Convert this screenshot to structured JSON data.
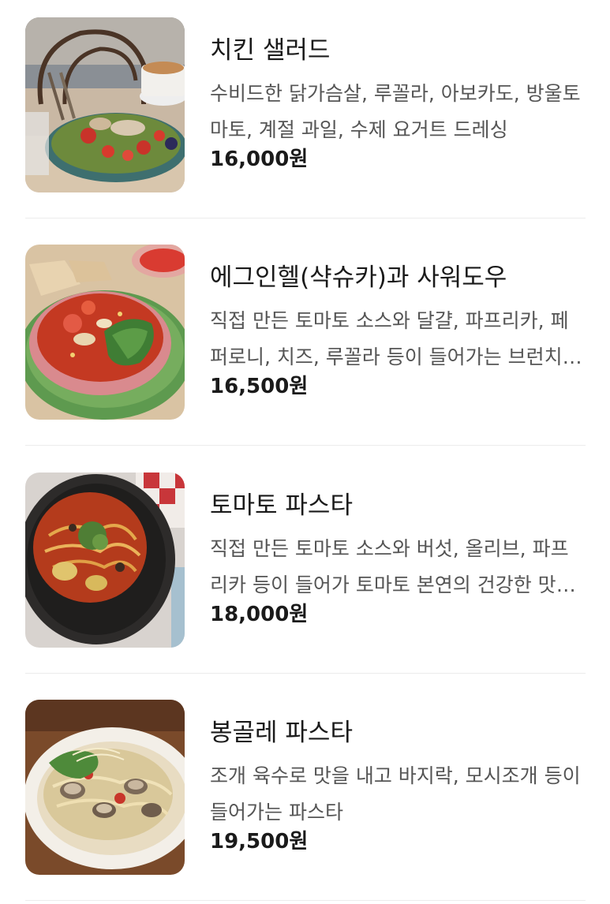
{
  "menu": {
    "items": [
      {
        "name": "치킨 샐러드",
        "description": "수비드한 닭가슴살, 루꼴라, 아보카도, 방울토마토, 계절 과일, 수제 요거트 드레싱",
        "price": "16,000원",
        "image": "chicken-salad-photo"
      },
      {
        "name": "에그인헬(샥슈카)과 사워도우",
        "description": "직접 만든 토마토 소스와 달걀, 파프리카, 페퍼로니, 치즈, 루꼴라 등이 들어가는 브런치 메뉴",
        "price": "16,500원",
        "image": "egg-in-hell-photo"
      },
      {
        "name": "토마토 파스타",
        "description": "직접 만든 토마토 소스와 버섯, 올리브, 파프리카 등이 들어가 토마토 본연의 건강한 맛을 살린 파스타",
        "price": "18,000원",
        "image": "tomato-pasta-photo"
      },
      {
        "name": "봉골레 파스타",
        "description": "조개 육수로 맛을 내고 바지락, 모시조개 등이 들어가는 파스타",
        "price": "19,500원",
        "image": "vongole-pasta-photo"
      }
    ]
  }
}
